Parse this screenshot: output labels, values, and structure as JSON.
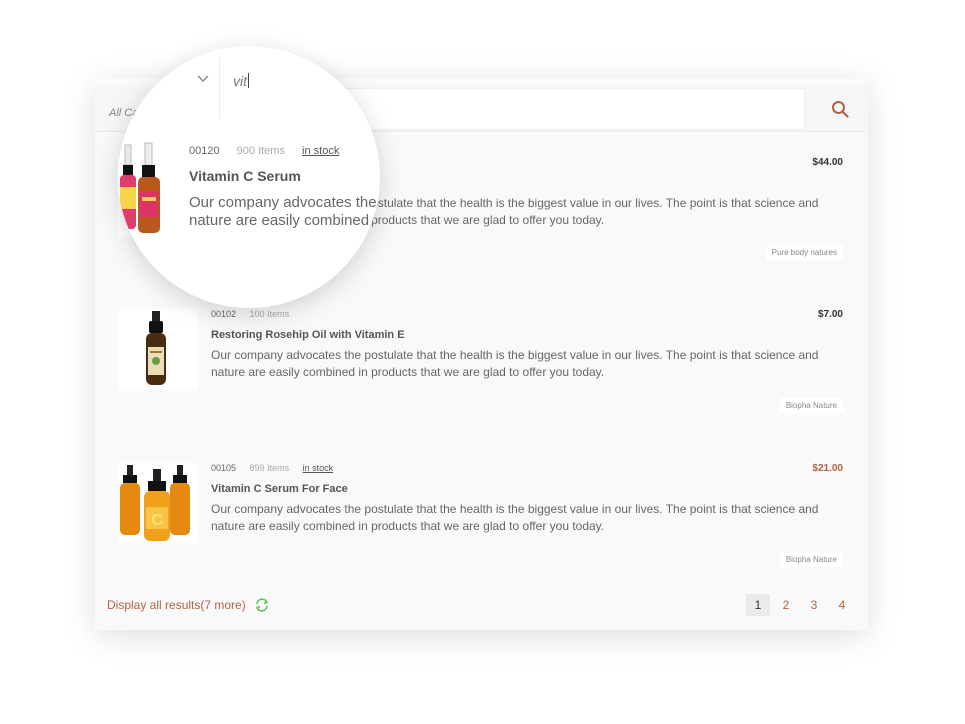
{
  "search": {
    "category_label": "All Categories",
    "query": "vit"
  },
  "results": [
    {
      "sku": "00120",
      "qty": "900 Items",
      "stock": "in stock",
      "title": "Vitamin C Serum",
      "desc": "Our company advocates the postulate that the health is the biggest value in our lives. The point is that science and nature are easily combined in products that we are glad to offer you today.",
      "price": "$44.00",
      "brand": "Pure body natures"
    },
    {
      "sku": "00102",
      "qty": "100 Items",
      "stock": "",
      "title": "Restoring Rosehip Oil with Vitamin E",
      "desc": "Our company advocates the postulate that the health is the biggest value in our lives. The point is that science and nature are easily combined in products that we are glad to offer you today.",
      "price": "$7.00",
      "brand": "Biopha Nature"
    },
    {
      "sku": "00105",
      "qty": "899 Items",
      "stock": "in stock",
      "title": "Vitamin C Serum For Face",
      "desc": "Our company advocates the postulate that the health is the biggest value in our lives. The point is that science and nature are easily combined in products that we are glad to offer you today.",
      "price": "$21.00",
      "brand": "Biopha Nature"
    }
  ],
  "footer": {
    "display_all": "Display all results(7 more)",
    "pages": [
      "1",
      "2",
      "3",
      "4"
    ],
    "active_page": "1"
  },
  "colors": {
    "accent": "#b26345",
    "refresh": "#5fbf5f"
  },
  "icons": {
    "search": "search-icon",
    "chevron": "chevron-down-icon",
    "refresh": "refresh-icon"
  }
}
